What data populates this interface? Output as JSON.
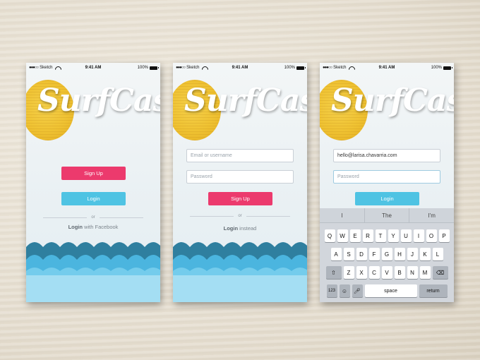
{
  "status_bar": {
    "carrier": "Sketch",
    "time": "9:41 AM",
    "battery": "100%"
  },
  "logo_text": "SurfCast",
  "screen1": {
    "signup_label": "Sign Up",
    "login_label": "Login",
    "or_label": "or",
    "fb_bold": "Login",
    "fb_rest": " with Facebook"
  },
  "screen2": {
    "email_placeholder": "Email or username",
    "password_placeholder": "Password",
    "signup_label": "Sign Up",
    "or_label": "or",
    "login_bold": "Login",
    "login_rest": " instead"
  },
  "screen3": {
    "email_value": "hello@larisa.chavarria.com",
    "password_placeholder": "Password",
    "login_label": "Login"
  },
  "keyboard": {
    "suggestions": [
      "I",
      "The",
      "I'm"
    ],
    "row1": [
      "Q",
      "W",
      "E",
      "R",
      "T",
      "Y",
      "U",
      "I",
      "O",
      "P"
    ],
    "row2": [
      "A",
      "S",
      "D",
      "F",
      "G",
      "H",
      "J",
      "K",
      "L"
    ],
    "row3": [
      "Z",
      "X",
      "C",
      "V",
      "B",
      "N",
      "M"
    ],
    "numbers_label": "123",
    "space_label": "space",
    "return_label": "return"
  },
  "colors": {
    "pink": "#ec3a6d",
    "blue": "#4fc3e3",
    "wave_dark": "#2f7f9f",
    "wave_light": "#4bb5df",
    "sun": "#efc232"
  }
}
